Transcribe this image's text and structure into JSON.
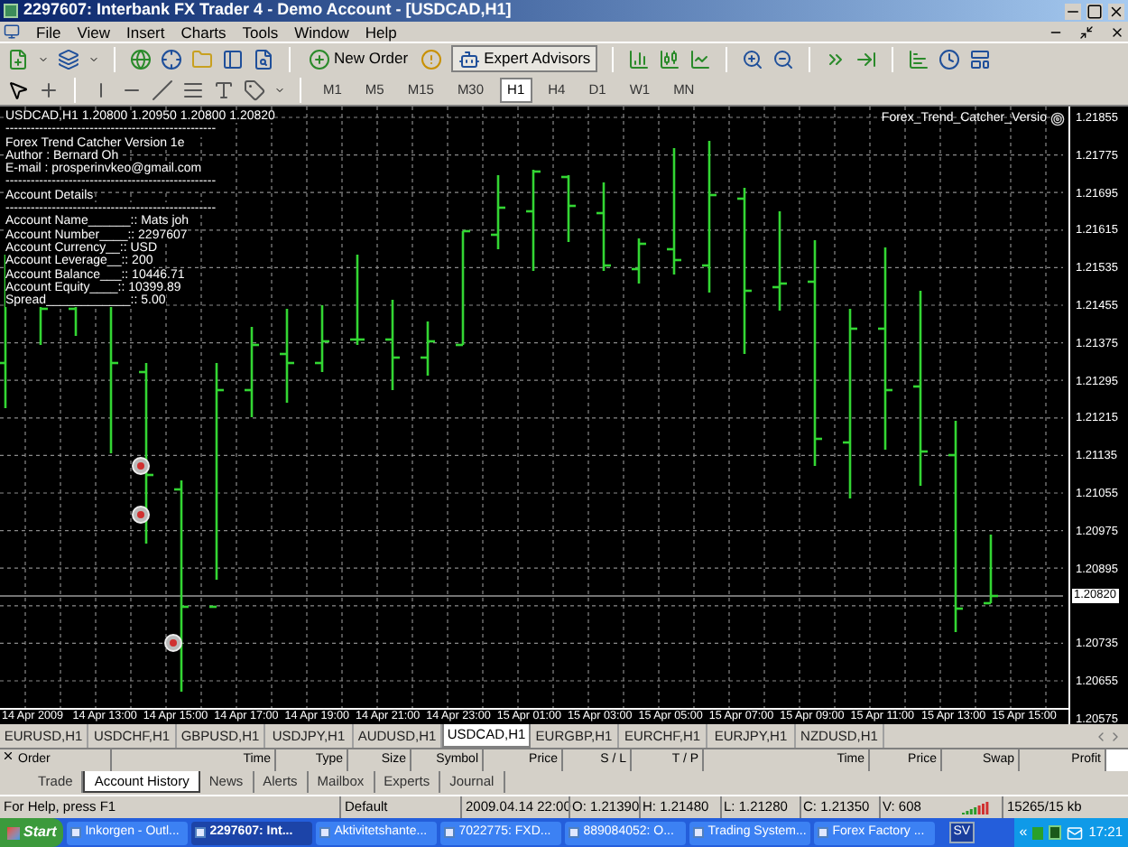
{
  "window": {
    "title": "2297607: Interbank FX Trader 4 - Demo Account - [USDCAD,H1]"
  },
  "menu": [
    "File",
    "View",
    "Insert",
    "Charts",
    "Tools",
    "Window",
    "Help"
  ],
  "toolbar_buttons": [
    "New Order",
    "Expert Advisors"
  ],
  "timeframes": [
    {
      "label": "M1",
      "selected": false
    },
    {
      "label": "M5",
      "selected": false
    },
    {
      "label": "M15",
      "selected": false
    },
    {
      "label": "M30",
      "selected": false
    },
    {
      "label": "H1",
      "selected": true
    },
    {
      "label": "H4",
      "selected": false
    },
    {
      "label": "D1",
      "selected": false
    },
    {
      "label": "W1",
      "selected": false
    },
    {
      "label": "MN",
      "selected": false
    }
  ],
  "chart": {
    "info_lines": [
      "USDCAD,H1  1.20800 1.20950 1.20800 1.20820",
      "--------------------------------------------------",
      "Forex Trend Catcher Version 1e",
      "Author : Bernard Oh",
      "E-mail : prosperinvkeo@gmail.com",
      "--------------------------------------------------",
      "Account Details",
      "--------------------------------------------------",
      "Account Name______:: Mats joh",
      "Account Number____:: 2297607",
      "Account Currency__:: USD",
      "Account Leverage__:: 200",
      "Account Balance___:: 10446.71",
      "Account Equity____:: 10399.89",
      "Spread____________:: 5.00"
    ],
    "indicator_name": "Forex_Trend_Catcher_Versio",
    "price_labels": [
      "1.21855",
      "1.21775",
      "1.21695",
      "1.21615",
      "1.21535",
      "1.21455",
      "1.21375",
      "1.21295",
      "1.21215",
      "1.21135",
      "1.21055",
      "1.20975",
      "1.20895",
      "1.20735",
      "1.20655",
      "1.20575"
    ],
    "current_price": "1.20820",
    "time_labels": [
      "14 Apr 2009",
      "14 Apr 13:00",
      "14 Apr 15:00",
      "14 Apr 17:00",
      "14 Apr 19:00",
      "14 Apr 21:00",
      "14 Apr 23:00",
      "15 Apr 01:00",
      "15 Apr 03:00",
      "15 Apr 05:00",
      "15 Apr 07:00",
      "15 Apr 09:00",
      "15 Apr 11:00",
      "15 Apr 13:00",
      "15 Apr 15:00"
    ]
  },
  "symbol_tabs": [
    {
      "label": "EURUSD,H1",
      "selected": false
    },
    {
      "label": "USDCHF,H1",
      "selected": false
    },
    {
      "label": "GBPUSD,H1",
      "selected": false
    },
    {
      "label": "USDJPY,H1",
      "selected": false
    },
    {
      "label": "AUDUSD,H1",
      "selected": false
    },
    {
      "label": "USDCAD,H1",
      "selected": true
    },
    {
      "label": "EURGBP,H1",
      "selected": false
    },
    {
      "label": "EURCHF,H1",
      "selected": false
    },
    {
      "label": "EURJPY,H1",
      "selected": false
    },
    {
      "label": "NZDUSD,H1",
      "selected": false
    }
  ],
  "terminal": {
    "columns": [
      "Order",
      "Time",
      "Type",
      "Size",
      "Symbol",
      "Price",
      "S / L",
      "T / P",
      "Time",
      "Price",
      "Swap",
      "Profit"
    ],
    "tabs": [
      {
        "label": "Trade",
        "selected": false
      },
      {
        "label": "Account History",
        "selected": true
      },
      {
        "label": "News",
        "selected": false
      },
      {
        "label": "Alerts",
        "selected": false
      },
      {
        "label": "Mailbox",
        "selected": false
      },
      {
        "label": "Experts",
        "selected": false
      },
      {
        "label": "Journal",
        "selected": false
      }
    ]
  },
  "status_bar": {
    "help": "For Help, press F1",
    "profile": "Default",
    "time": "2009.04.14 22:00",
    "open": "O: 1.21390",
    "high": "H: 1.21480",
    "low": "L: 1.21280",
    "close": "C: 1.21350",
    "volume": "V: 608",
    "traffic": "15265/15 kb"
  },
  "taskbar": {
    "start": "Start",
    "items": [
      {
        "label": "Inkorgen - Outl...",
        "selected": false
      },
      {
        "label": "2297607: Int...",
        "selected": true
      },
      {
        "label": "Aktivitetshante...",
        "selected": false
      },
      {
        "label": "7022775: FXD...",
        "selected": false
      },
      {
        "label": "889084052: O...",
        "selected": false
      },
      {
        "label": "Trading System...",
        "selected": false
      },
      {
        "label": "Forex Factory ...",
        "selected": false
      }
    ],
    "language": "SV",
    "tray_toggle": "«",
    "clock": "17:21"
  }
}
